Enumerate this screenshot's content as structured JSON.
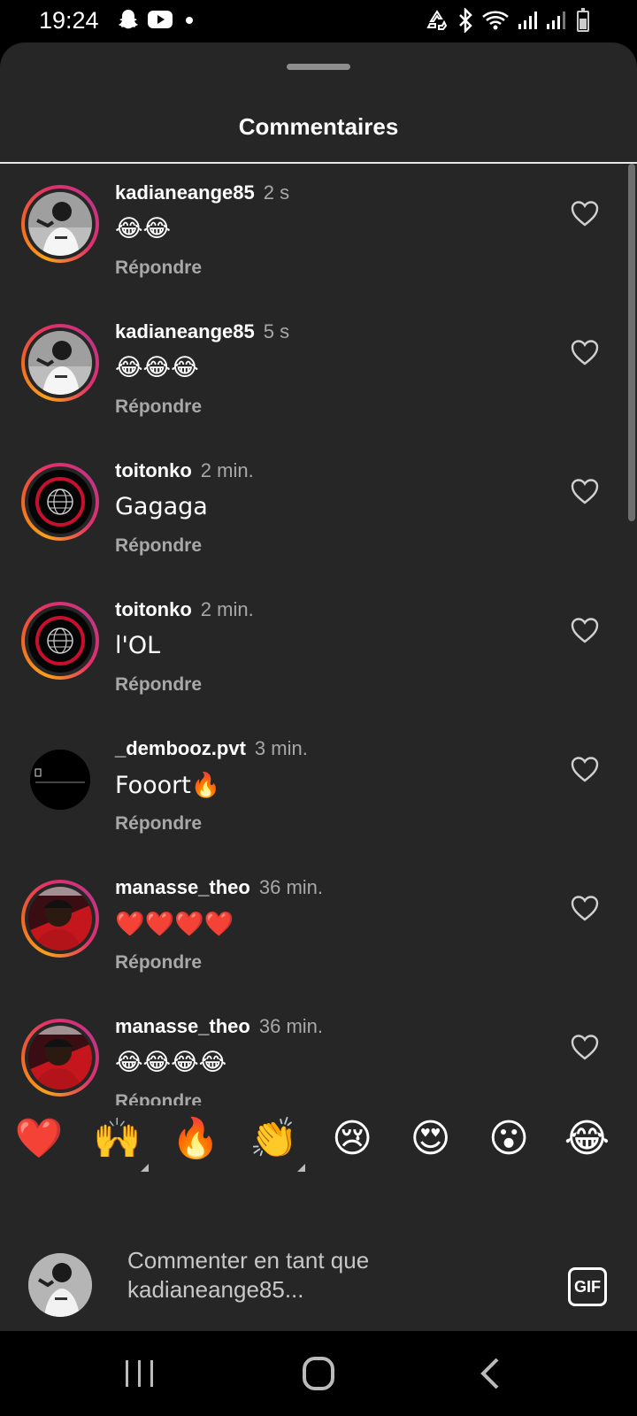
{
  "status_bar": {
    "time": "19:24",
    "left_icons": [
      "snapchat-icon",
      "youtube-icon",
      "dot-icon"
    ],
    "right_icons": [
      "recycle-icon",
      "bluetooth-icon",
      "wifi-icon",
      "signal-icon",
      "signal-icon-2",
      "battery-icon"
    ],
    "battery_level": 0.6
  },
  "sheet": {
    "title": "Commentaires"
  },
  "comments": [
    {
      "user": "kadianeange85",
      "time": "2 s",
      "text": "😂😂",
      "reply": "Répondre",
      "avatar": "avatar-kadianeange85",
      "ring": true
    },
    {
      "user": "kadianeange85",
      "time": "5 s",
      "text": "😂😂😂",
      "reply": "Répondre",
      "avatar": "avatar-kadianeange85",
      "ring": true
    },
    {
      "user": "toitonko",
      "time": "2 min.",
      "text": "Gagaga",
      "reply": "Répondre",
      "avatar": "avatar-toitonko",
      "ring": true
    },
    {
      "user": "toitonko",
      "time": "2 min.",
      "text": "l'OL",
      "reply": "Répondre",
      "avatar": "avatar-toitonko",
      "ring": true
    },
    {
      "user": "_dembooz.pvt",
      "time": "3 min.",
      "text": "Fooort🔥",
      "reply": "Répondre",
      "avatar": "avatar-dembooz",
      "ring": false
    },
    {
      "user": "manasse_theo",
      "time": "36 min.",
      "text": "❤️❤️❤️❤️",
      "reply": "Répondre",
      "avatar": "avatar-manasse",
      "ring": true
    },
    {
      "user": "manasse_theo",
      "time": "36 min.",
      "text": "😂😂😂😂",
      "reply": "Répondre",
      "avatar": "avatar-manasse",
      "ring": true
    }
  ],
  "emoji_bar": {
    "emojis": [
      "❤️",
      "🙌",
      "🔥",
      "👏",
      "😢",
      "😍",
      "😮",
      "😂"
    ]
  },
  "composer": {
    "placeholder": "Commenter en tant que kadianeange85...",
    "gif_label": "GIF"
  },
  "nav_bar": {
    "buttons": [
      "recent-apps-icon",
      "home-icon",
      "back-icon"
    ]
  },
  "colors": {
    "sheet_bg": "#262626",
    "secondary_text": "#a8a8a8",
    "ring_gradient": [
      "#f9a11b",
      "#e1306c",
      "#c13584"
    ]
  }
}
